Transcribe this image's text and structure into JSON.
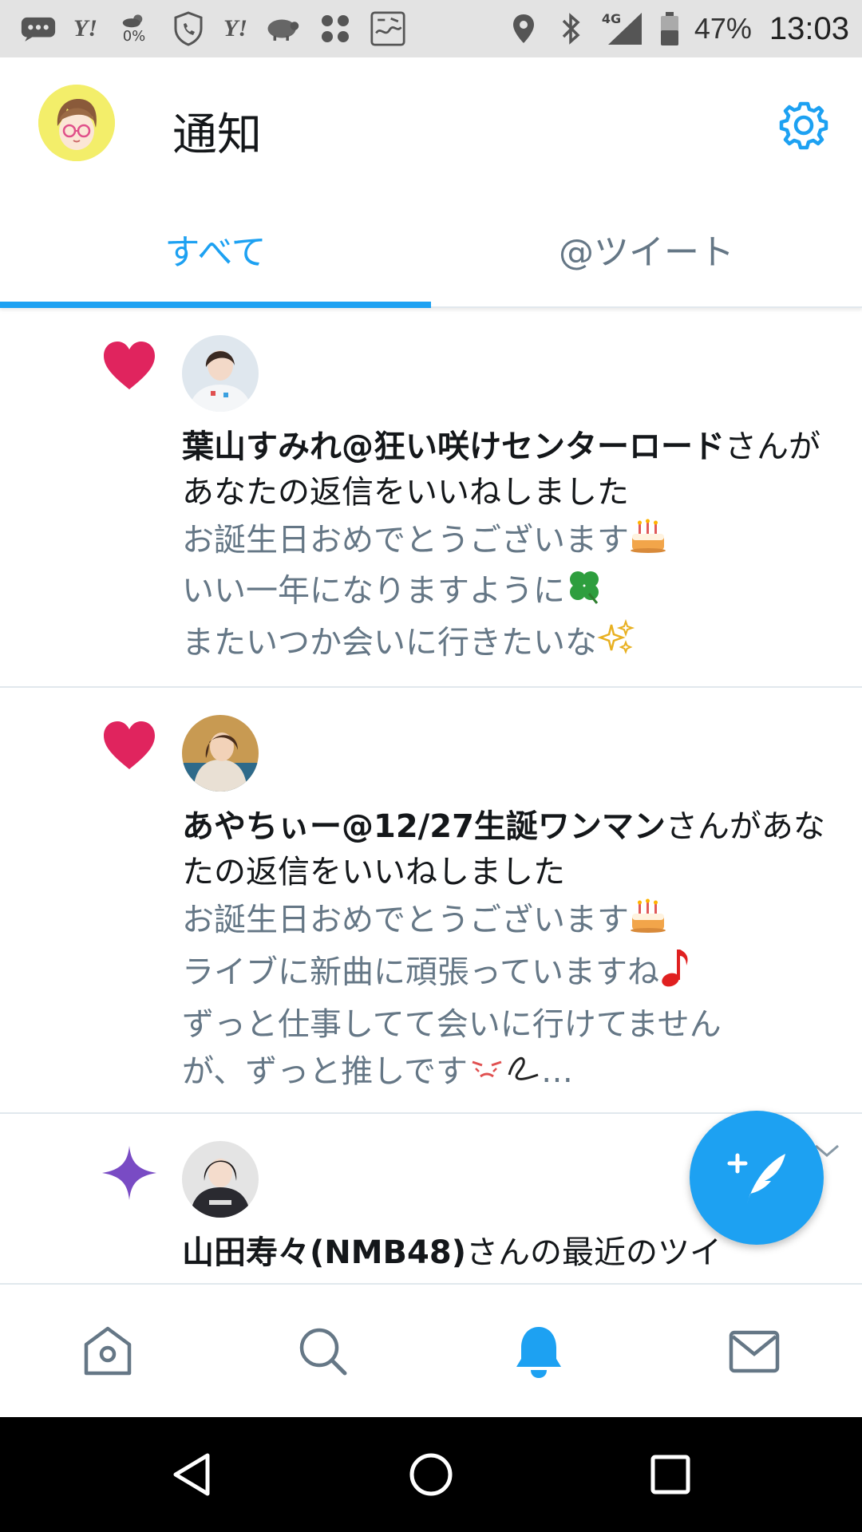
{
  "status_bar": {
    "yahoo_1": "Y!",
    "yahoo_2": "Y!",
    "weather_percent": "0%",
    "network": "4G",
    "battery": "47%",
    "time": "13:03"
  },
  "header": {
    "title": "通知"
  },
  "tabs": [
    {
      "label": "すべて",
      "active": true
    },
    {
      "label": "@ツイート",
      "active": false
    }
  ],
  "notifications": [
    {
      "type": "like",
      "user": "葉山すみれ@狂い咲けセンターロード",
      "action": "さんがあなたの返信をいいねしました",
      "quote_lines": [
        "お誕生日おめでとうございます",
        "いい一年になりますように",
        "またいつか会いに行きたいな"
      ],
      "quote_emojis": [
        "birthday-cake",
        "four-leaf-clover",
        "sparkles"
      ]
    },
    {
      "type": "like",
      "user": "あやちぃー@12/27生誕ワンマン",
      "action": "さんがあなたの返信をいいねしました",
      "quote_lines": [
        "お誕生日おめでとうございます",
        "ライブに新曲に頑張っていますね",
        "ずっと仕事してて会いに行けてません",
        "が、ずっと推しです"
      ],
      "quote_emojis": [
        "birthday-cake",
        "musical-note",
        "",
        "tearful-face"
      ],
      "ellipsis": "…"
    },
    {
      "type": "recommended",
      "user": "山田寿々(NMB48)",
      "action": "さんの最近のツイ"
    }
  ],
  "fab": {
    "icon": "compose-tweet-icon"
  },
  "bottom_nav": [
    "home-icon",
    "search-icon",
    "notifications-icon",
    "messages-icon"
  ],
  "colors": {
    "accent": "#1da1f2",
    "like": "#e0245e",
    "sparkle": "#794bc4",
    "muted": "#657786",
    "status_bar": "#e3e3e3"
  }
}
